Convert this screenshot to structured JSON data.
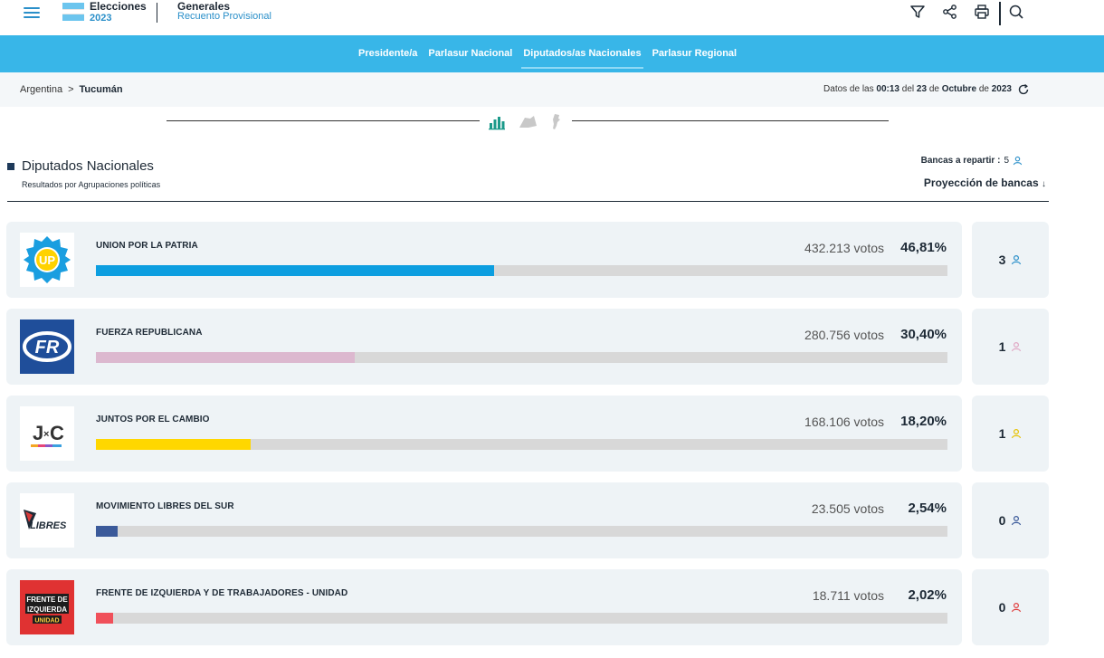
{
  "header": {
    "brand_title": "Elecciones",
    "brand_year": "2023",
    "election_title": "Generales",
    "election_subtitle": "Recuento Provisional"
  },
  "nav": {
    "tabs": [
      {
        "label": "Presidente/a"
      },
      {
        "label": "Parlasur Nacional"
      },
      {
        "label": "Diputados/as Nacionales"
      },
      {
        "label": "Parlasur Regional"
      }
    ],
    "active_tab": "Diputados/as Nacionales"
  },
  "breadcrumb": {
    "root": "Argentina",
    "separator": ">",
    "current": "Tucumán"
  },
  "datestamp": {
    "prefix": "Datos de las",
    "time": "00:13",
    "del": "del",
    "day": "23",
    "de1": "de",
    "month": "Octubre",
    "de2": "de",
    "year": "2023"
  },
  "section": {
    "title": "Diputados Nacionales",
    "subtitle": "Resultados por Agrupaciones políticas",
    "bancas_label": "Bancas a repartir :",
    "bancas_value": "5",
    "projection_label": "Proyección de bancas"
  },
  "results": [
    {
      "name": "UNION POR LA PATRIA",
      "votes": "432.213 votos",
      "percent": "46,81%",
      "share": 0.4681,
      "color": "#0c9ee0",
      "seats": "3",
      "seat_color": "#2a8fc9",
      "logo": "up-logo"
    },
    {
      "name": "FUERZA REPUBLICANA",
      "votes": "280.756 votos",
      "percent": "30,40%",
      "share": 0.304,
      "color": "#dcb8cf",
      "seats": "1",
      "seat_color": "#e0a8c4",
      "logo": "fr-logo"
    },
    {
      "name": "JUNTOS POR EL CAMBIO",
      "votes": "168.106 votos",
      "percent": "18,20%",
      "share": 0.182,
      "color": "#ffd700",
      "seats": "1",
      "seat_color": "#e6c200",
      "logo": "jxc-logo"
    },
    {
      "name": "MOVIMIENTO LIBRES DEL SUR",
      "votes": "23.505 votos",
      "percent": "2,54%",
      "share": 0.0254,
      "color": "#3b5a9a",
      "seats": "0",
      "seat_color": "#3b5a9a",
      "logo": "libres-logo"
    },
    {
      "name": "FRENTE DE IZQUIERDA Y DE TRABAJADORES - UNIDAD",
      "votes": "18.711 votos",
      "percent": "2,02%",
      "share": 0.0202,
      "color": "#f0505a",
      "seats": "0",
      "seat_color": "#e04040",
      "logo": "fit-logo"
    }
  ],
  "logo_text": {
    "up": "UP",
    "fr": "FR",
    "jxc_j": "J",
    "jxc_x": "×",
    "jxc_c": "C",
    "libres": "LIBRES",
    "fit_line1": "FRENTE DE",
    "fit_line2": "IZQUIERDA",
    "fit_line3": "UNIDAD"
  }
}
